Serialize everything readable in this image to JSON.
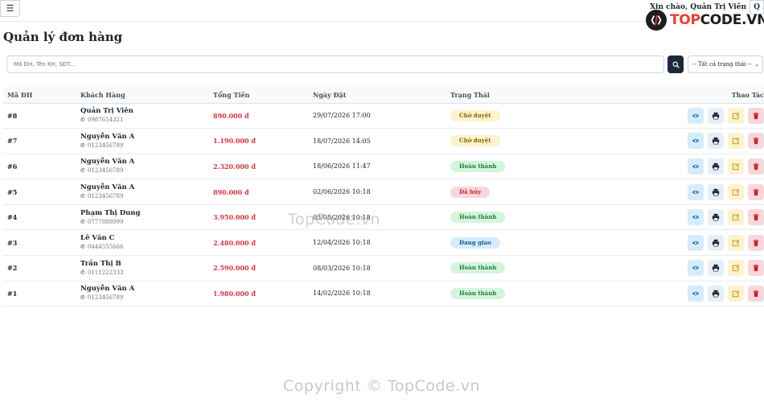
{
  "topbar": {
    "menu_icon": "hamburger-icon",
    "greeting": "Xin chào, Quản Trị Viên",
    "avatar_letter": "Q"
  },
  "logo": {
    "part1": "TOP",
    "part2": "CODE.VN"
  },
  "page": {
    "title": "Quản lý đơn hàng"
  },
  "filters": {
    "search_placeholder": "Mã ĐH, Tên KH, SĐT...",
    "status_selected": "-- Tất cả trạng thái --"
  },
  "table": {
    "headers": {
      "id": "Mã ĐH",
      "customer": "Khách Hàng",
      "total": "Tổng Tiền",
      "date": "Ngày Đặt",
      "status": "Trạng Thái",
      "actions": "Thao Tác"
    },
    "rows": [
      {
        "id": "#8",
        "name": "Quản Trị Viên",
        "phone": "0987654321",
        "total": "890.000 đ",
        "date": "29/07/2026 17:00",
        "status": "Chờ duyệt",
        "status_type": "pending"
      },
      {
        "id": "#7",
        "name": "Nguyễn Văn A",
        "phone": "0123456789",
        "total": "1.190.000 đ",
        "date": "18/07/2026 14:05",
        "status": "Chờ duyệt",
        "status_type": "pending"
      },
      {
        "id": "#6",
        "name": "Nguyễn Văn A",
        "phone": "0123456789",
        "total": "2.320.000 đ",
        "date": "18/06/2026 11:47",
        "status": "Hoàn thành",
        "status_type": "done"
      },
      {
        "id": "#5",
        "name": "Nguyễn Văn A",
        "phone": "0123456789",
        "total": "890.000 đ",
        "date": "02/06/2026 10:18",
        "status": "Đã hủy",
        "status_type": "cancel"
      },
      {
        "id": "#4",
        "name": "Phạm Thị Dung",
        "phone": "0777888999",
        "total": "3.950.000 đ",
        "date": "03/05/2026 10:18",
        "status": "Hoàn thành",
        "status_type": "done"
      },
      {
        "id": "#3",
        "name": "Lê Văn C",
        "phone": "0444555666",
        "total": "2.480.000 đ",
        "date": "12/04/2026 10:18",
        "status": "Đang giao",
        "status_type": "shipping"
      },
      {
        "id": "#2",
        "name": "Trần Thị B",
        "phone": "0111222333",
        "total": "2.590.000 đ",
        "date": "08/03/2026 10:18",
        "status": "Hoàn thành",
        "status_type": "done"
      },
      {
        "id": "#1",
        "name": "Nguyễn Văn A",
        "phone": "0123456789",
        "total": "1.980.000 đ",
        "date": "14/02/2026 10:18",
        "status": "Hoàn thành",
        "status_type": "done"
      }
    ]
  },
  "watermarks": {
    "center": "TopCode.vn",
    "bottom": "Copyright © TopCode.vn"
  },
  "colors": {
    "primary_dark": "#1b2a3a",
    "danger": "#dc3545",
    "logo_red": "#e8412c"
  }
}
